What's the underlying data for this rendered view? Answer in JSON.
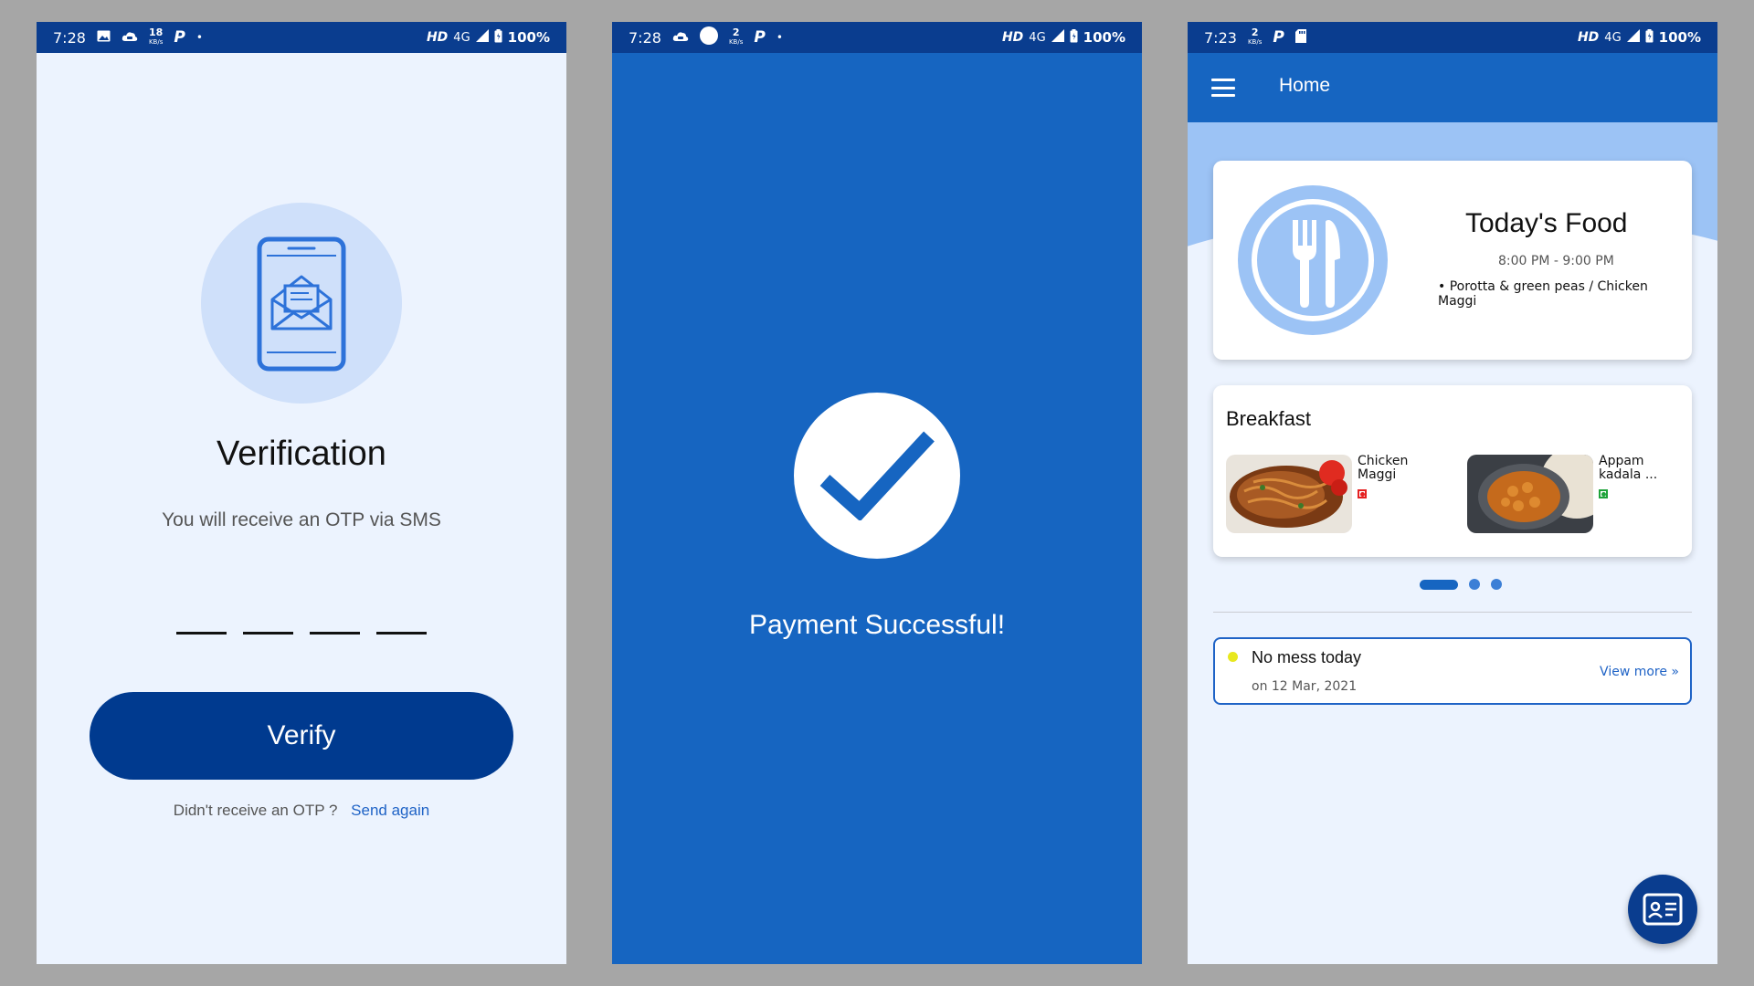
{
  "colors": {
    "background": "#a6a6a6",
    "status_bar": "#0a3d8f",
    "primary": "#1665c1",
    "dark_primary": "#003a8f",
    "light_bg": "#ecf3fe",
    "light_blue": "#9cc3f5",
    "accent_link": "#1f63c6"
  },
  "verification_screen": {
    "status": {
      "time": "7:28",
      "speed": "18",
      "speed_unit": "KB/s",
      "network": "HD",
      "net_type": "4G",
      "battery": "100%",
      "icons": [
        "image-icon",
        "cloud-game-icon",
        "p-icon",
        "dot-icon"
      ]
    },
    "title": "Verification",
    "subtitle": "You will receive an OTP via SMS",
    "otp_digits": [
      "",
      "",
      "",
      ""
    ],
    "verify_label": "Verify",
    "resend_prompt": "Didn't receive an OTP ?",
    "resend_link": "Send again",
    "illustration": "phone-envelope-icon"
  },
  "payment_screen": {
    "status": {
      "time": "7:28",
      "speed": "2",
      "speed_unit": "KB/s",
      "network": "HD",
      "net_type": "4G",
      "battery": "100%",
      "icons": [
        "cloud-game-icon",
        "circle-icon",
        "p-icon",
        "dot-icon"
      ]
    },
    "message": "Payment Successful!",
    "icon": "checkmark-icon"
  },
  "home_screen": {
    "status": {
      "time": "7:23",
      "speed": "2",
      "speed_unit": "KB/s",
      "network": "HD",
      "net_type": "4G",
      "battery": "100%",
      "icons": [
        "p-icon",
        "sd-card-icon"
      ]
    },
    "appbar_title": "Home",
    "today_food": {
      "title": "Today's Food",
      "time": "8:00 PM - 9:00 PM",
      "items": "• Porotta & green peas / Chicken Maggi",
      "icon": "fork-knife-plate-icon"
    },
    "breakfast": {
      "title": "Breakfast",
      "items": [
        {
          "name": "Chicken Maggi",
          "type": "non-veg",
          "mark_color": "#e52020"
        },
        {
          "name": "Appam kadala ...",
          "type": "veg",
          "mark_color": "#1ea33a"
        }
      ]
    },
    "carousel": {
      "active_index": 0,
      "count": 3
    },
    "notice": {
      "title": "No mess today",
      "date": "on 12 Mar, 2021",
      "link": "View more »"
    },
    "fab_icon": "id-card-icon"
  }
}
